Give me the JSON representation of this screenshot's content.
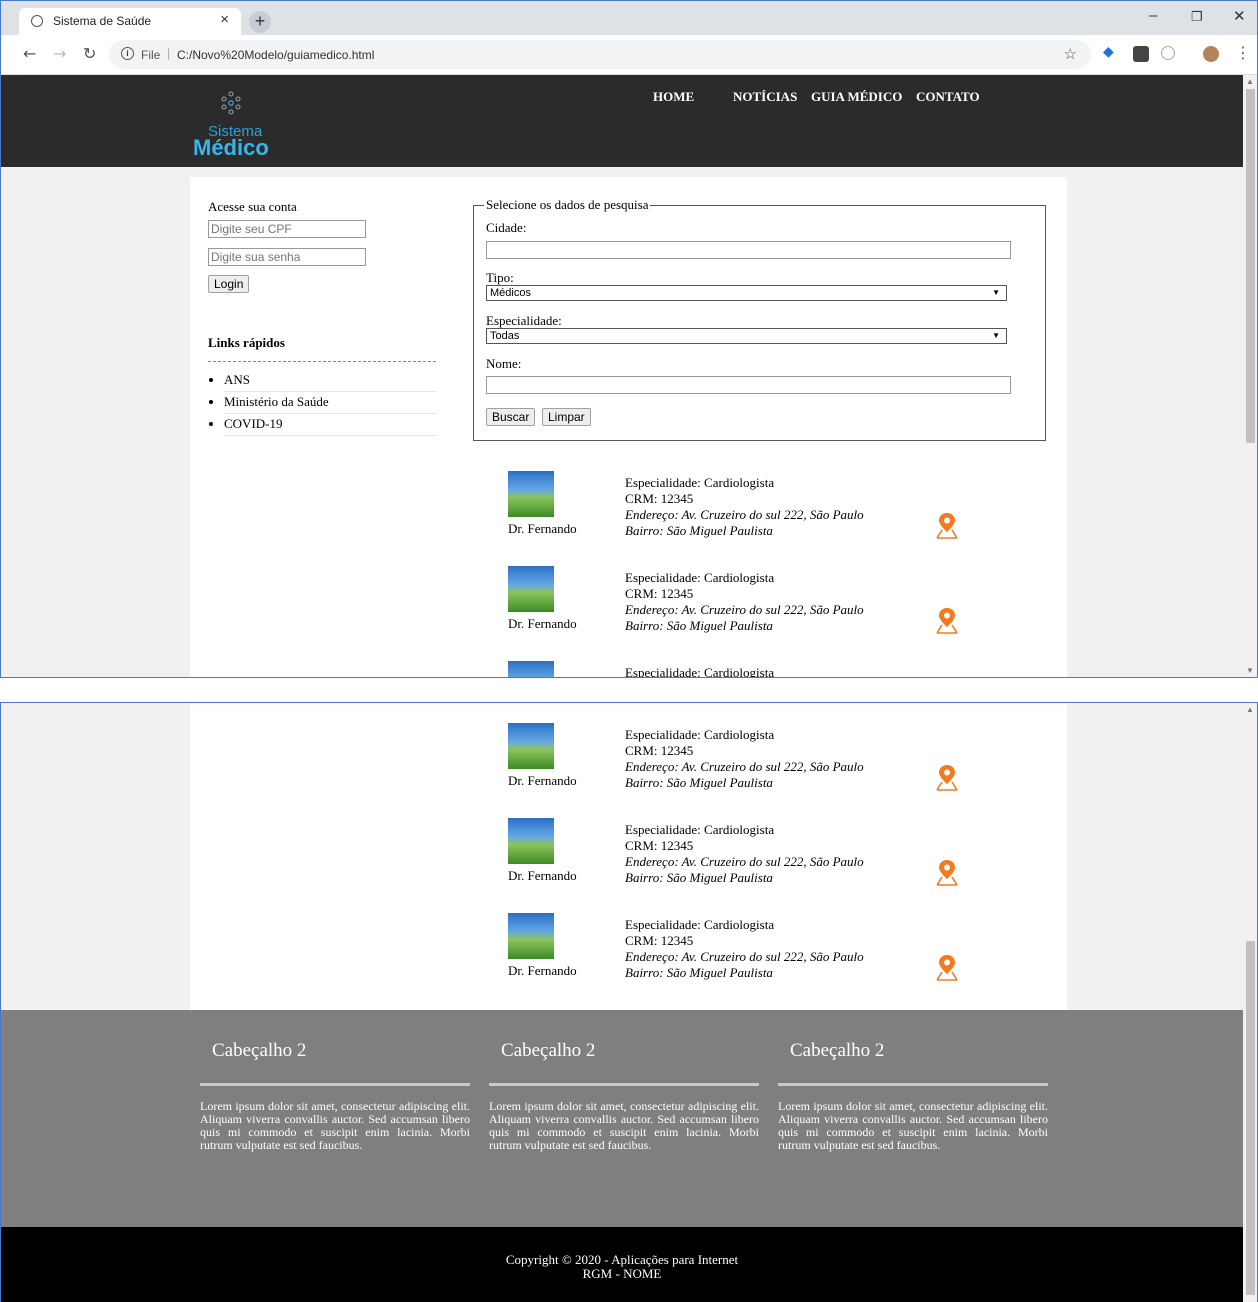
{
  "browser": {
    "tab_title": "Sistema de Saúde",
    "url_scheme": "File",
    "url": "C:/Novo%20Modelo/guiamedico.html"
  },
  "header": {
    "logo_line1": "Sistema",
    "logo_line2": "Médico",
    "nav": [
      "HOME",
      "NOTÍCIAS",
      "GUIA MÉDICO",
      "CONTATO"
    ]
  },
  "login": {
    "title": "Acesse sua conta",
    "cpf_placeholder": "Digite seu CPF",
    "senha_placeholder": "Digite sua senha",
    "button": "Login"
  },
  "quick_links": {
    "title": "Links rápidos",
    "items": [
      "ANS",
      "Ministério da Saúde",
      "COVID-19"
    ]
  },
  "search": {
    "legend": "Selecione os dados de pesquisa",
    "cidade_label": "Cidade:",
    "tipo_label": "Tipo:",
    "tipo_value": "Médicos",
    "especialidade_label": "Especialidade:",
    "especialidade_value": "Todas",
    "nome_label": "Nome:",
    "buscar": "Buscar",
    "limpar": "Limpar"
  },
  "doctor": {
    "name": "Dr. Fernando",
    "especialidade": "Especialidade: Cardiologista",
    "crm": "CRM: 12345",
    "endereco": "Endereço: Av. Cruzeiro do sul 222, São Paulo",
    "bairro": "Bairro: São Miguel Paulista"
  },
  "footer": {
    "columns": [
      {
        "heading": "Cabeçalho 2",
        "text": "Lorem ipsum dolor sit amet, consectetur adipiscing elit. Aliquam viverra convallis auctor. Sed accumsan libero quis mi commodo et suscipit enim lacinia. Morbi rutrum vulputate est sed faucibus."
      },
      {
        "heading": "Cabeçalho 2",
        "text": "Lorem ipsum dolor sit amet, consectetur adipiscing elit. Aliquam viverra convallis auctor. Sed accumsan libero quis mi commodo et suscipit enim lacinia. Morbi rutrum vulputate est sed faucibus."
      },
      {
        "heading": "Cabeçalho 2",
        "text": "Lorem ipsum dolor sit amet, consectetur adipiscing elit. Aliquam viverra convallis auctor. Sed accumsan libero quis mi commodo et suscipit enim lacinia. Morbi rutrum vulputate est sed faucibus."
      }
    ],
    "copyright": "Copyright © 2020 - Aplicações para Internet",
    "rgm": "RGM - NOME"
  },
  "colors": {
    "header_bg": "#2b2b2b",
    "logo_blue": "#3ab5ea",
    "pin_orange": "#f47a20",
    "footer_bg": "#7f7f7f",
    "copyright_bg": "#000000"
  },
  "icons": [
    "globe-icon",
    "close-icon",
    "plus-icon",
    "back-icon",
    "forward-icon",
    "reload-icon",
    "info-icon",
    "star-icon",
    "map-pin-icon"
  ]
}
